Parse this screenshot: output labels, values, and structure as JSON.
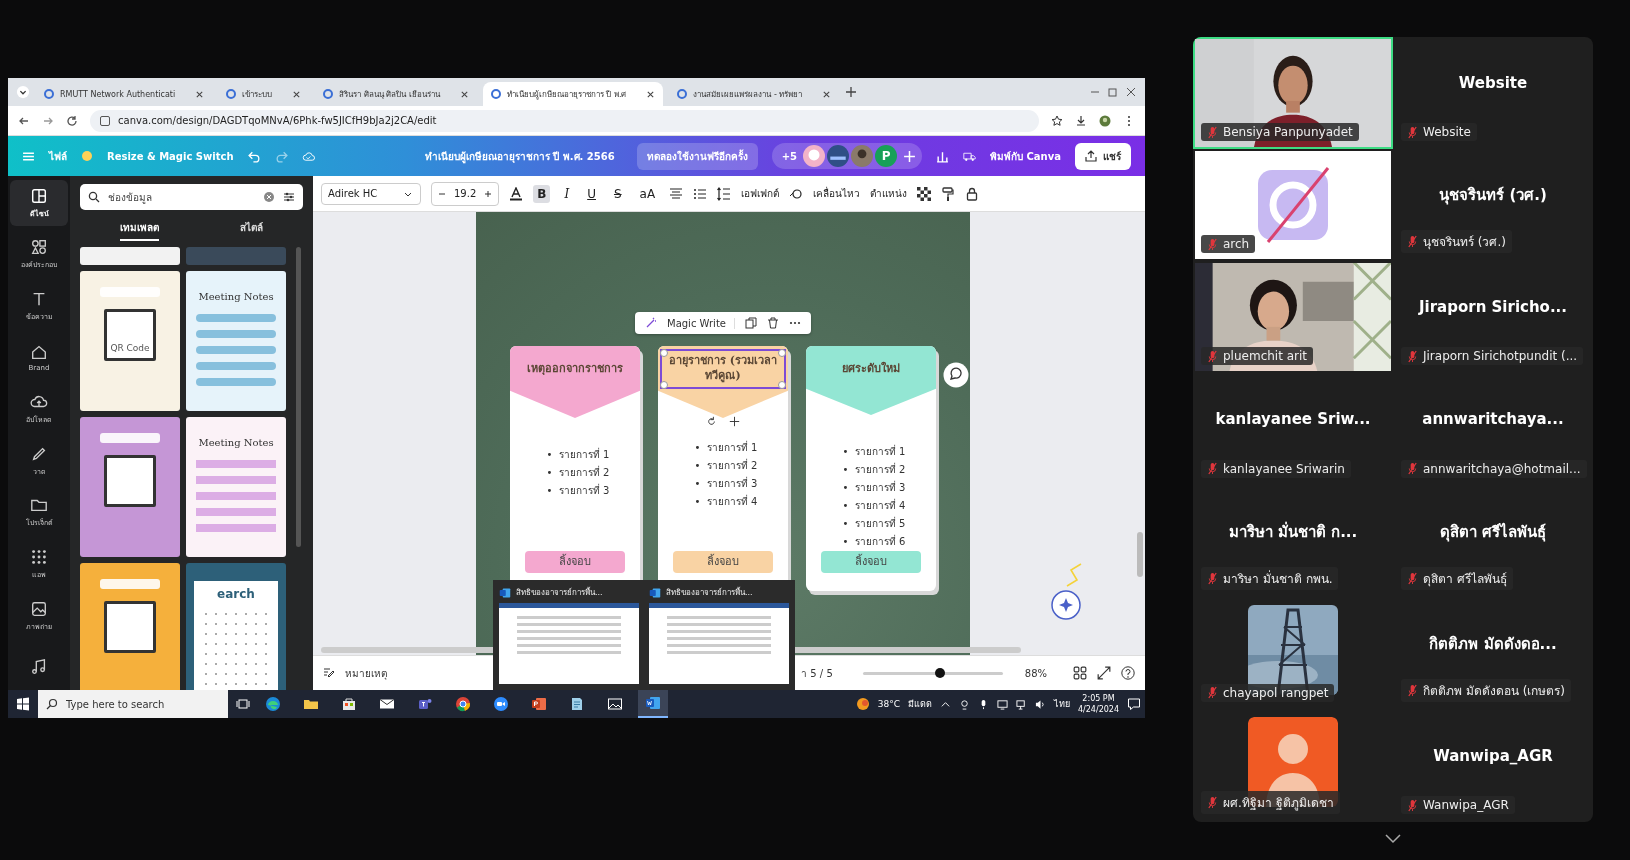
{
  "browser": {
    "tabs": [
      {
        "label": "RMUTT Network Authenticati",
        "selected": false
      },
      {
        "label": "เข้าระบบ",
        "selected": false
      },
      {
        "label": "สิรินรา ศิลนนุ ศิลปิน เยือนร่าน",
        "selected": false
      },
      {
        "label": "ทำเนียบผู้เกษียณอายุราชการ ปี พ.ศ",
        "selected": true
      },
      {
        "label": "งานสมัยเผยแพร่ผลงาน - ทรัพยา",
        "selected": false
      }
    ],
    "url": "canva.com/design/DAGDTqoMNvA/6Phk-fw5JICfH9bJa2j2CA/edit"
  },
  "header": {
    "file": "ไฟล์",
    "resize": "Resize & Magic Switch",
    "title": "ทำเนียบผู้เกษียณอายุราชการ ปี พ.ศ. 2566",
    "trial": "ทดลองใช้งานฟรีอีกครั้ง",
    "extra_people": "+5",
    "initial": "P",
    "print": "พิมพ์กับ Canva",
    "share": "แชร์"
  },
  "rail": [
    {
      "kind": "design",
      "label": "ดีไซน์",
      "selected": true
    },
    {
      "kind": "elements",
      "label": "องค์ประกอบ",
      "selected": false
    },
    {
      "kind": "text",
      "label": "ข้อความ",
      "selected": false
    },
    {
      "kind": "brand",
      "label": "Brand",
      "selected": false
    },
    {
      "kind": "upload",
      "label": "อัปโหลด",
      "selected": false
    },
    {
      "kind": "draw",
      "label": "วาด",
      "selected": false
    },
    {
      "kind": "folder",
      "label": "โปรเจ็กต์",
      "selected": false
    },
    {
      "kind": "apps",
      "label": "แอพ",
      "selected": false
    },
    {
      "kind": "photos",
      "label": "ภาพถ่าย",
      "selected": false
    },
    {
      "kind": "audio",
      "selected": false
    }
  ],
  "side_panel": {
    "search": "ช่องข้อมูล",
    "tabs": [
      {
        "label": "เทมเพลต",
        "selected": true
      },
      {
        "label": "สไตล์",
        "selected": false
      }
    ],
    "thumbnails": [
      {
        "kind": "strip",
        "color": "#f2f2f2"
      },
      {
        "kind": "strip",
        "color": "#3a4a5a"
      },
      {
        "kind": "qr",
        "color": "#f8f2e4",
        "text": "QR Code"
      },
      {
        "kind": "notes",
        "color": "#e6f3fa",
        "text": "Meeting Notes"
      },
      {
        "kind": "qr",
        "color": "#c596d6"
      },
      {
        "kind": "notes",
        "color": "#fbf2f7",
        "text": "Meeting Notes"
      },
      {
        "kind": "qr",
        "color": "#f5b03c"
      },
      {
        "kind": "calendar",
        "color": "#2d6079",
        "text": "earch"
      }
    ]
  },
  "toolbar": {
    "font": "Adirek HC",
    "size": "19.2",
    "format": [
      {
        "label": "B",
        "selected": true
      },
      {
        "label": "I",
        "selected": false
      },
      {
        "label": "U",
        "selected": false
      },
      {
        "label": "S",
        "selected": false
      },
      {
        "label": "aA",
        "selected": false
      }
    ],
    "effects": "เอฟเฟกต์",
    "animate": "เคลื่อนไหว",
    "position": "ตำแหน่ง"
  },
  "canvas": {
    "magic_write": "Magic Write",
    "bullet": "•",
    "cards": [
      {
        "title": "เหตุออกจากราชการ",
        "color": "#f4a8cf",
        "selected": false,
        "items": [
          "รายการที่ 1",
          "รายการที่ 2",
          "รายการที่ 3"
        ],
        "button": "ลิ้งจอบ"
      },
      {
        "title": "อายุราชการ (รวมเวลาทวีคูณ)",
        "color": "#f9d3a4",
        "selected": true,
        "items": [
          "รายการที่ 1",
          "รายการที่ 2",
          "รายการที่ 3",
          "รายการที่ 4"
        ],
        "button": "ลิ้งจอบ"
      },
      {
        "title": "ยศระดับใหม่",
        "color": "#93e6d3",
        "selected": false,
        "items": [
          "รายการที่ 1",
          "รายการที่ 2",
          "รายการที่ 3",
          "รายการที่ 4",
          "รายการที่ 5",
          "รายการที่ 6"
        ],
        "button": "ลิ้งจอบ"
      }
    ]
  },
  "footer": {
    "notes": "หมายเหตุ",
    "page": "า 5 / 5",
    "zoom": {
      "level": 0.55
    },
    "zoom_text": "88%"
  },
  "previews": [
    {
      "title": "สิทธิของอาจารย์การพื้น..."
    },
    {
      "title": "สิทธิของอาจารย์การพื้น..."
    }
  ],
  "taskbar": {
    "search": {
      "placeholder": "Type here to search"
    },
    "apps": [
      {
        "kind": "edge",
        "selected": false
      },
      {
        "kind": "folder",
        "selected": false
      },
      {
        "kind": "store",
        "selected": false
      },
      {
        "kind": "mail",
        "selected": false
      },
      {
        "kind": "teams",
        "selected": false
      },
      {
        "kind": "chrome",
        "selected": false
      },
      {
        "kind": "zoom",
        "selected": false
      },
      {
        "kind": "slides",
        "selected": false
      },
      {
        "kind": "notepad",
        "selected": false
      },
      {
        "kind": "photos",
        "selected": false
      },
      {
        "kind": "word",
        "selected": true
      }
    ],
    "temperature": "38°C",
    "weather": "มีแดด",
    "language": "ไทย",
    "time": "2:05 PM",
    "date": "4/24/2024"
  },
  "participants": [
    {
      "kind": "video",
      "name": "Bensiya Panpunyadet",
      "muted": true,
      "speaking": true
    },
    {
      "kind": "logo",
      "name": "arch",
      "muted": true,
      "speaking": false
    },
    {
      "kind": "video",
      "name": "pluemchit arit",
      "muted": true,
      "speaking": false
    },
    {
      "kind": "name",
      "title": "kanlayanee Sriw...",
      "name": "kanlayanee Sriwarin",
      "muted": true,
      "speaking": false
    },
    {
      "kind": "name",
      "title": "มาริษา มั่นชาติ ก...",
      "name": "มาริษา มั่นชาติ กพน.",
      "muted": true,
      "speaking": false
    },
    {
      "name": "chayapol rangpet",
      "muted": true,
      "speaking": false
    },
    {
      "kind": "avatar",
      "name": "ผศ.ทิฐิมา ฐิติภูมิเดชา",
      "muted": true,
      "speaking": false
    },
    {
      "kind": "name",
      "title": "Website",
      "name": "Website",
      "muted": true,
      "speaking": false
    },
    {
      "kind": "name",
      "title": "นุชจรินทร์ (วศ.)",
      "name": "นุชจรินทร์ (วศ.)",
      "muted": true,
      "speaking": false
    },
    {
      "kind": "name",
      "title": "Jiraporn Siricho...",
      "name": "Jiraporn Sirichotpundit (...",
      "muted": true,
      "speaking": false
    },
    {
      "kind": "name",
      "title": "annwaritchaya...",
      "name": "annwaritchaya@hotmail...",
      "muted": true,
      "speaking": false
    },
    {
      "kind": "name",
      "title": "ดุสิตา ศรีไลพันธุ์",
      "name": "ดุสิตา ศรีไลพันธุ์",
      "muted": true,
      "speaking": false
    },
    {
      "kind": "name",
      "title": "กิตติภพ มัดดังดอ...",
      "name": "กิตติภพ มัดดังดอน (เกษตร)",
      "muted": true,
      "speaking": false
    },
    {
      "kind": "name",
      "title": "Wanwipa_AGR",
      "name": "Wanwipa_AGR",
      "muted": true,
      "speaking": false
    }
  ]
}
